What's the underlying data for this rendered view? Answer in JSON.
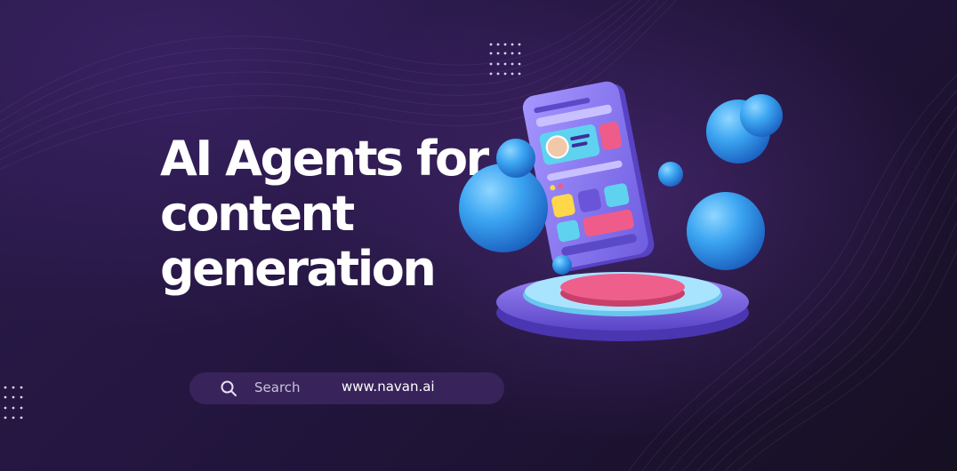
{
  "headline": {
    "lines": [
      "AI Agents for",
      "content",
      "generation"
    ]
  },
  "search": {
    "icon": "search-icon",
    "label": "Search",
    "website": "www.navan.ai"
  },
  "colors": {
    "background": "#241640",
    "text": "#ffffff",
    "search_bar": "#3c2660",
    "phone": "#8d7cf0",
    "spheres": "#3aa4f0",
    "podium_top": "#e9527e",
    "podium_base": "#8a74e8"
  }
}
